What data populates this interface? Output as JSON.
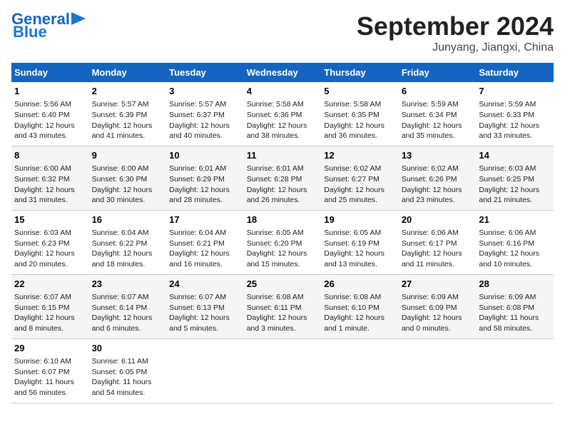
{
  "header": {
    "logo_line1": "General",
    "logo_line2": "Blue",
    "title": "September 2024",
    "subtitle": "Junyang, Jiangxi, China"
  },
  "days_of_week": [
    "Sunday",
    "Monday",
    "Tuesday",
    "Wednesday",
    "Thursday",
    "Friday",
    "Saturday"
  ],
  "weeks": [
    [
      {
        "num": "1",
        "info": "Sunrise: 5:56 AM\nSunset: 6:40 PM\nDaylight: 12 hours and 43 minutes."
      },
      {
        "num": "2",
        "info": "Sunrise: 5:57 AM\nSunset: 6:39 PM\nDaylight: 12 hours and 41 minutes."
      },
      {
        "num": "3",
        "info": "Sunrise: 5:57 AM\nSunset: 6:37 PM\nDaylight: 12 hours and 40 minutes."
      },
      {
        "num": "4",
        "info": "Sunrise: 5:58 AM\nSunset: 6:36 PM\nDaylight: 12 hours and 38 minutes."
      },
      {
        "num": "5",
        "info": "Sunrise: 5:58 AM\nSunset: 6:35 PM\nDaylight: 12 hours and 36 minutes."
      },
      {
        "num": "6",
        "info": "Sunrise: 5:59 AM\nSunset: 6:34 PM\nDaylight: 12 hours and 35 minutes."
      },
      {
        "num": "7",
        "info": "Sunrise: 5:59 AM\nSunset: 6:33 PM\nDaylight: 12 hours and 33 minutes."
      }
    ],
    [
      {
        "num": "8",
        "info": "Sunrise: 6:00 AM\nSunset: 6:32 PM\nDaylight: 12 hours and 31 minutes."
      },
      {
        "num": "9",
        "info": "Sunrise: 6:00 AM\nSunset: 6:30 PM\nDaylight: 12 hours and 30 minutes."
      },
      {
        "num": "10",
        "info": "Sunrise: 6:01 AM\nSunset: 6:29 PM\nDaylight: 12 hours and 28 minutes."
      },
      {
        "num": "11",
        "info": "Sunrise: 6:01 AM\nSunset: 6:28 PM\nDaylight: 12 hours and 26 minutes."
      },
      {
        "num": "12",
        "info": "Sunrise: 6:02 AM\nSunset: 6:27 PM\nDaylight: 12 hours and 25 minutes."
      },
      {
        "num": "13",
        "info": "Sunrise: 6:02 AM\nSunset: 6:26 PM\nDaylight: 12 hours and 23 minutes."
      },
      {
        "num": "14",
        "info": "Sunrise: 6:03 AM\nSunset: 6:25 PM\nDaylight: 12 hours and 21 minutes."
      }
    ],
    [
      {
        "num": "15",
        "info": "Sunrise: 6:03 AM\nSunset: 6:23 PM\nDaylight: 12 hours and 20 minutes."
      },
      {
        "num": "16",
        "info": "Sunrise: 6:04 AM\nSunset: 6:22 PM\nDaylight: 12 hours and 18 minutes."
      },
      {
        "num": "17",
        "info": "Sunrise: 6:04 AM\nSunset: 6:21 PM\nDaylight: 12 hours and 16 minutes."
      },
      {
        "num": "18",
        "info": "Sunrise: 6:05 AM\nSunset: 6:20 PM\nDaylight: 12 hours and 15 minutes."
      },
      {
        "num": "19",
        "info": "Sunrise: 6:05 AM\nSunset: 6:19 PM\nDaylight: 12 hours and 13 minutes."
      },
      {
        "num": "20",
        "info": "Sunrise: 6:06 AM\nSunset: 6:17 PM\nDaylight: 12 hours and 11 minutes."
      },
      {
        "num": "21",
        "info": "Sunrise: 6:06 AM\nSunset: 6:16 PM\nDaylight: 12 hours and 10 minutes."
      }
    ],
    [
      {
        "num": "22",
        "info": "Sunrise: 6:07 AM\nSunset: 6:15 PM\nDaylight: 12 hours and 8 minutes."
      },
      {
        "num": "23",
        "info": "Sunrise: 6:07 AM\nSunset: 6:14 PM\nDaylight: 12 hours and 6 minutes."
      },
      {
        "num": "24",
        "info": "Sunrise: 6:07 AM\nSunset: 6:13 PM\nDaylight: 12 hours and 5 minutes."
      },
      {
        "num": "25",
        "info": "Sunrise: 6:08 AM\nSunset: 6:11 PM\nDaylight: 12 hours and 3 minutes."
      },
      {
        "num": "26",
        "info": "Sunrise: 6:08 AM\nSunset: 6:10 PM\nDaylight: 12 hours and 1 minute."
      },
      {
        "num": "27",
        "info": "Sunrise: 6:09 AM\nSunset: 6:09 PM\nDaylight: 12 hours and 0 minutes."
      },
      {
        "num": "28",
        "info": "Sunrise: 6:09 AM\nSunset: 6:08 PM\nDaylight: 11 hours and 58 minutes."
      }
    ],
    [
      {
        "num": "29",
        "info": "Sunrise: 6:10 AM\nSunset: 6:07 PM\nDaylight: 11 hours and 56 minutes."
      },
      {
        "num": "30",
        "info": "Sunrise: 6:11 AM\nSunset: 6:05 PM\nDaylight: 11 hours and 54 minutes."
      },
      {
        "num": "",
        "info": ""
      },
      {
        "num": "",
        "info": ""
      },
      {
        "num": "",
        "info": ""
      },
      {
        "num": "",
        "info": ""
      },
      {
        "num": "",
        "info": ""
      }
    ]
  ]
}
